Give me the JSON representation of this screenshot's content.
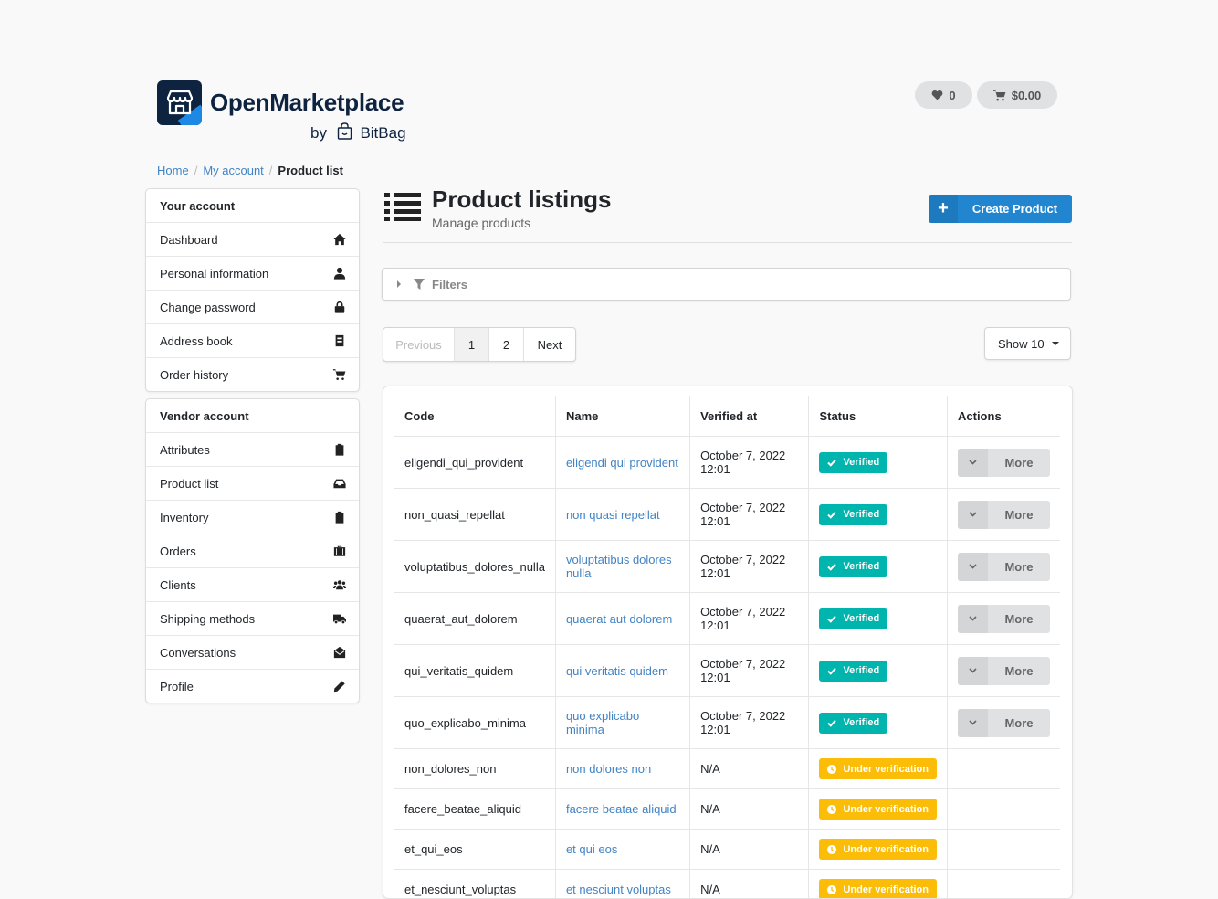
{
  "brand": {
    "name": "OpenMarketplace",
    "by": "by",
    "company": "BitBag"
  },
  "header": {
    "wishlist_count": "0",
    "cart_total": "$0.00"
  },
  "breadcrumb": {
    "home": "Home",
    "account": "My account",
    "current": "Product list"
  },
  "sidebar": {
    "your_account": {
      "title": "Your account",
      "items": [
        {
          "label": "Dashboard",
          "icon": "home-icon"
        },
        {
          "label": "Personal information",
          "icon": "user-icon"
        },
        {
          "label": "Change password",
          "icon": "lock-icon"
        },
        {
          "label": "Address book",
          "icon": "address-book-icon"
        },
        {
          "label": "Order history",
          "icon": "cart-icon"
        }
      ]
    },
    "vendor_account": {
      "title": "Vendor account",
      "items": [
        {
          "label": "Attributes",
          "icon": "clipboard-icon"
        },
        {
          "label": "Product list",
          "icon": "inbox-icon"
        },
        {
          "label": "Inventory",
          "icon": "clipboard-icon"
        },
        {
          "label": "Orders",
          "icon": "briefcase-icon"
        },
        {
          "label": "Clients",
          "icon": "users-icon"
        },
        {
          "label": "Shipping methods",
          "icon": "truck-icon"
        },
        {
          "label": "Conversations",
          "icon": "envelope-open-icon"
        },
        {
          "label": "Profile",
          "icon": "pencil-icon"
        }
      ]
    }
  },
  "page": {
    "title": "Product listings",
    "subtitle": "Manage products",
    "create_label": "Create Product",
    "filters_label": "Filters"
  },
  "pagination": {
    "previous": "Previous",
    "pages": [
      "1",
      "2"
    ],
    "next": "Next",
    "show": "Show 10"
  },
  "table": {
    "columns": [
      "Code",
      "Name",
      "Verified at",
      "Status",
      "Actions"
    ],
    "more_label": "More",
    "rows": [
      {
        "code": "eligendi_qui_provident",
        "name": "eligendi qui provident",
        "verified_at": "October 7, 2022 12:01",
        "status": "Verified"
      },
      {
        "code": "non_quasi_repellat",
        "name": "non quasi repellat",
        "verified_at": "October 7, 2022 12:01",
        "status": "Verified"
      },
      {
        "code": "voluptatibus_dolores_nulla",
        "name": "voluptatibus dolores nulla",
        "verified_at": "October 7, 2022 12:01",
        "status": "Verified"
      },
      {
        "code": "quaerat_aut_dolorem",
        "name": "quaerat aut dolorem",
        "verified_at": "October 7, 2022 12:01",
        "status": "Verified"
      },
      {
        "code": "qui_veritatis_quidem",
        "name": "qui veritatis quidem",
        "verified_at": "October 7, 2022 12:01",
        "status": "Verified"
      },
      {
        "code": "quo_explicabo_minima",
        "name": "quo explicabo minima",
        "verified_at": "October 7, 2022 12:01",
        "status": "Verified"
      },
      {
        "code": "non_dolores_non",
        "name": "non dolores non",
        "verified_at": "N/A",
        "status": "Under verification"
      },
      {
        "code": "facere_beatae_aliquid",
        "name": "facere beatae aliquid",
        "verified_at": "N/A",
        "status": "Under verification"
      },
      {
        "code": "et_qui_eos",
        "name": "et qui eos",
        "verified_at": "N/A",
        "status": "Under verification"
      },
      {
        "code": "et_nesciunt_voluptas",
        "name": "et nesciunt voluptas",
        "verified_at": "N/A",
        "status": "Under verification"
      }
    ]
  },
  "colors": {
    "primary": "#2185d0",
    "verified": "#00b5ad",
    "pending": "#fbbd08",
    "link": "#4183c4"
  }
}
